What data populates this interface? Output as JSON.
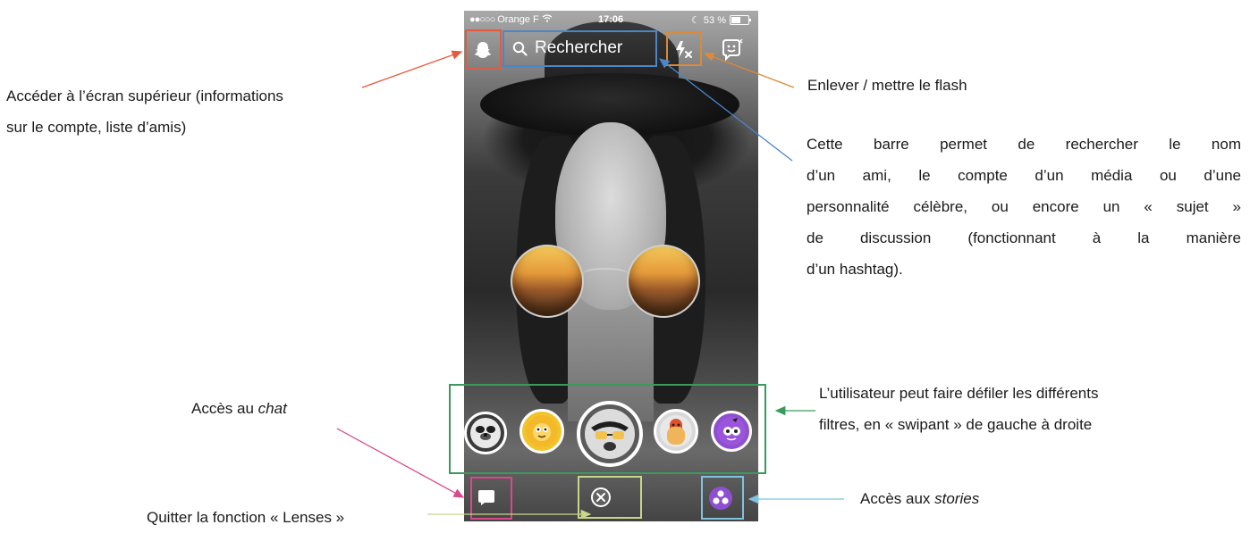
{
  "status_bar": {
    "carrier": "Orange F",
    "time": "17:06",
    "battery": "53 %"
  },
  "search": {
    "label": "Rechercher"
  },
  "lenses": {
    "count_visible": 5,
    "selected_index": 2
  },
  "annotations": {
    "ghost_line1": "Accéder à l’écran supérieur (informations",
    "ghost_line2": "sur le compte, liste d’amis)",
    "flash": "Enlever / mettre le flash",
    "search_lines": [
      "Cette barre permet de rechercher le nom",
      "d’un ami, le compte d’un média ou d’une",
      "personnalité célèbre, ou encore un « sujet »",
      "de discussion (fonctionnant à la manière",
      "d’un hashtag)."
    ],
    "filters_line1": "L’utilisateur peut faire défiler les différents",
    "filters_line2": "filtres, en « swipant » de gauche à droite",
    "chat_prefix": "Accès au ",
    "chat_em": "chat",
    "stories_prefix": "Accès aux ",
    "stories_em": "stories",
    "quit": "Quitter la fonction « Lenses »"
  },
  "colors": {
    "ghost_box": "#e8583a",
    "search_box": "#4a86c8",
    "flash_box": "#d98a3a",
    "carousel_box": "#3a9a5c",
    "chat_box": "#d94a8c",
    "close_box": "#c8d68a",
    "stories_box": "#7ec3e0",
    "stories_badge": "#8e4fd0"
  }
}
